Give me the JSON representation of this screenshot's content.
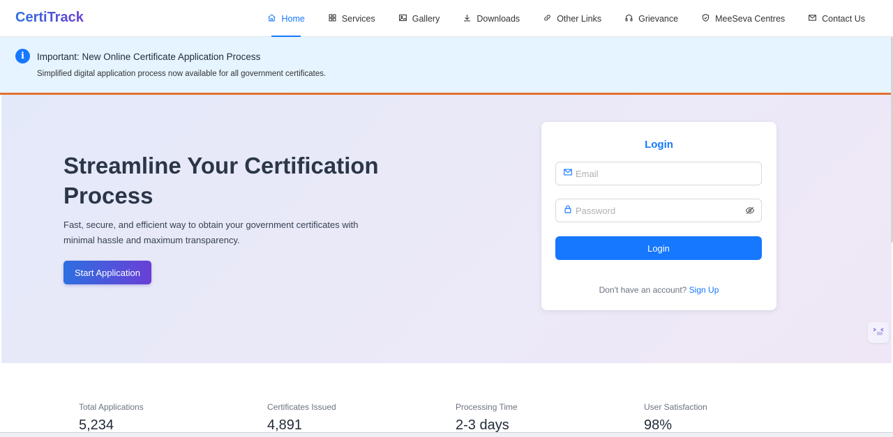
{
  "header": {
    "logo": "CertiTrack",
    "nav": [
      {
        "label": "Home",
        "icon": "home-icon",
        "active": true
      },
      {
        "label": "Services",
        "icon": "grid-icon"
      },
      {
        "label": "Gallery",
        "icon": "image-icon"
      },
      {
        "label": "Downloads",
        "icon": "download-icon"
      },
      {
        "label": "Other Links",
        "icon": "link-icon"
      },
      {
        "label": "Grievance",
        "icon": "headphones-icon"
      },
      {
        "label": "MeeSeva Centres",
        "icon": "shield-icon"
      },
      {
        "label": "Contact Us",
        "icon": "mail-icon"
      }
    ]
  },
  "notice": {
    "icon": "info-icon",
    "title": "Important: New Online Certificate Application Process",
    "subtitle": "Simplified digital application process now available for all government certificates."
  },
  "hero": {
    "title": "Streamline Your Certification Process",
    "description": "Fast, secure, and efficient way to obtain your government certificates with minimal hassle and maximum transparency.",
    "cta": "Start Application"
  },
  "login": {
    "title": "Login",
    "email_placeholder": "Email",
    "password_placeholder": "Password",
    "button": "Login",
    "signup_prompt": "Don't have an account?",
    "signup_link": "Sign Up"
  },
  "stats": [
    {
      "label": "Total Applications",
      "value": "5,234"
    },
    {
      "label": "Certificates Issued",
      "value": "4,891"
    },
    {
      "label": "Processing Time",
      "value": "2-3 days"
    },
    {
      "label": "User Satisfaction",
      "value": "98%"
    }
  ],
  "colors": {
    "primary": "#1677ff",
    "accent_gradient_start": "#2d6fe0",
    "accent_gradient_end": "#6a3fd6",
    "notice_bg": "#e6f4ff",
    "notice_border": "#e2712e"
  }
}
